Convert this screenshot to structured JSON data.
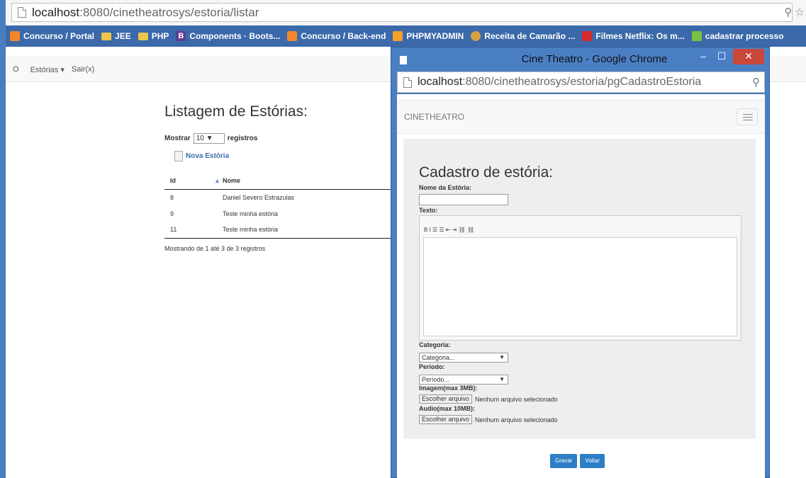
{
  "browser": {
    "url_host": "localhost",
    "url_path": ":8080/cinetheatrosys/estoria/listar",
    "addr_icons": "⚲ ☆"
  },
  "bookmarks": [
    {
      "label": "Concurso / Portal",
      "icon": "orange-icon"
    },
    {
      "label": "JEE",
      "icon": "folder-icon"
    },
    {
      "label": "PHP",
      "icon": "folder-icon"
    },
    {
      "label": "Components · Boots...",
      "icon": "bootstrap-icon"
    },
    {
      "label": "Concurso / Back-end",
      "icon": "orange-icon"
    },
    {
      "label": "PHPMYADMIN",
      "icon": "phpmyadmin-icon"
    },
    {
      "label": "Receita de Camarão ...",
      "icon": "shrimp-icon"
    },
    {
      "label": "Filmes Netflix: Os m...",
      "icon": "netflix-icon"
    },
    {
      "label": "cadastrar processo",
      "icon": "green-icon"
    }
  ],
  "nav": {
    "brand_char": "O",
    "menu_estorias": "Estórias ▾",
    "menu_sair": "Sair(x)"
  },
  "listing": {
    "title": "Listagem de Estórias:",
    "mostrar_label": "Mostrar",
    "mostrar_value": "10",
    "registros_label": "registros",
    "nova_label": "Nova Estória",
    "col_id": "Id",
    "col_nome": "Nome",
    "rows": [
      {
        "id": "8",
        "nome": "Daniel Severo Estrazulas"
      },
      {
        "id": "9",
        "nome": "Teste minha estória"
      },
      {
        "id": "11",
        "nome": "Teste minha estória"
      }
    ],
    "footer": "Mostrando de 1 até 3 de 3 registros"
  },
  "popup": {
    "window_title": "Cine Theatro - Google Chrome",
    "url_host": "localhost",
    "url_path": ":8080/cinetheatrosys/estoria/pgCadastroEstoria",
    "brand": "CINETHEATRO",
    "form_title": "Cadastro de estória:",
    "nome_label": "Nome da Estória:",
    "texto_label": "Texto:",
    "toolbar": "B  I  ☰  ☰  ⇤  ⇥  ⛓  ⛓",
    "categoria_label": "Categoria:",
    "categoria_value": "Categoria...",
    "periodo_label": "Período:",
    "periodo_value": "Período...",
    "imagem_label": "Imagem(max 3MB):",
    "audio_label": "Audio(max 10MB):",
    "file_button": "Escolher arquivo",
    "file_status": "Nenhum arquivo selecionado",
    "gravar": "Gravar",
    "voltar": "Voltar"
  }
}
